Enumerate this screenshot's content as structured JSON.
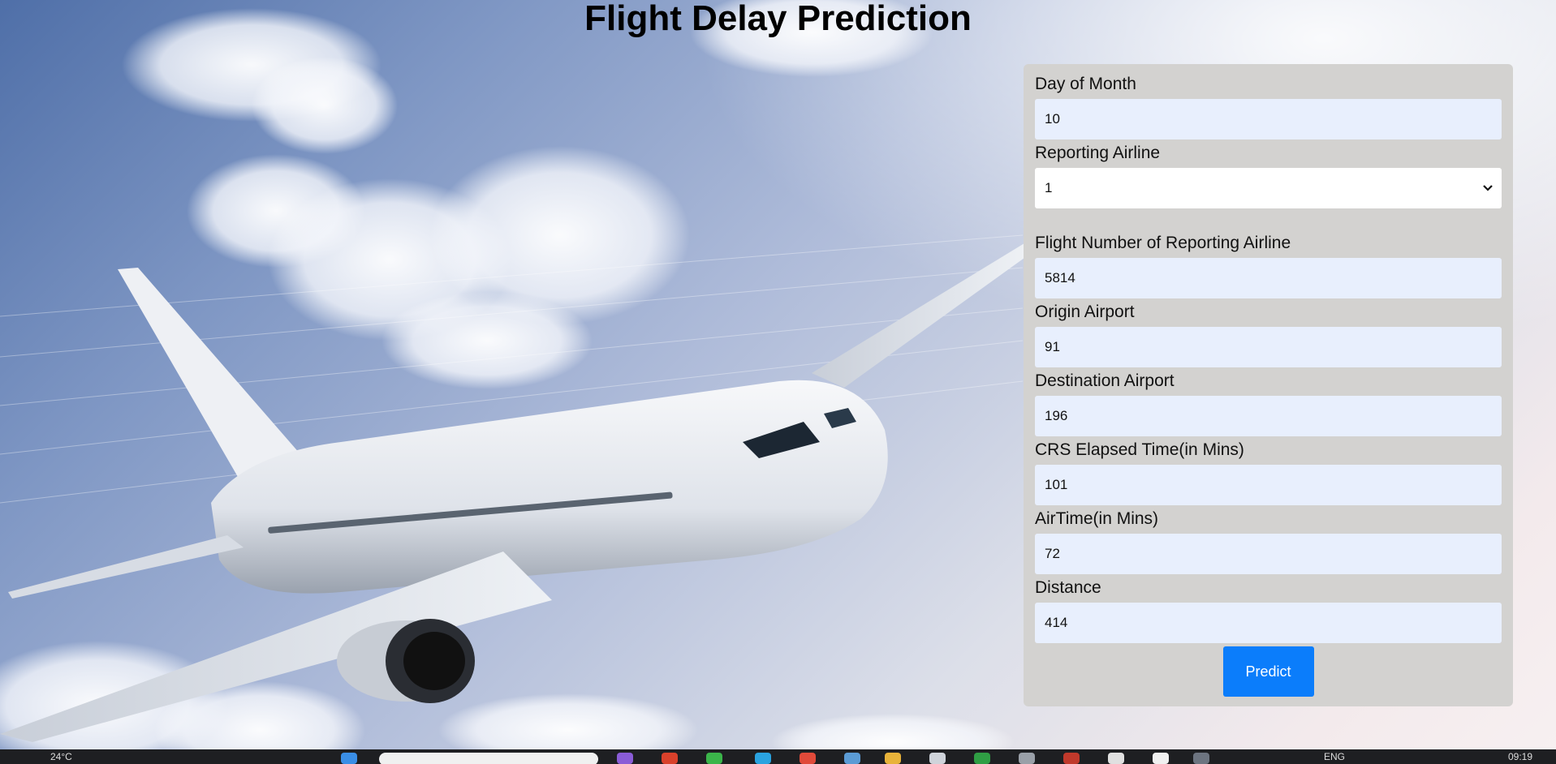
{
  "page": {
    "title": "Flight Delay Prediction"
  },
  "form": {
    "fields": [
      {
        "label": "Day of Month",
        "value": "10",
        "type": "input"
      },
      {
        "label": "Reporting Airline",
        "value": "1",
        "type": "select"
      },
      {
        "label": "Flight Number of Reporting Airline",
        "value": "5814",
        "type": "input"
      },
      {
        "label": "Origin Airport",
        "value": "91",
        "type": "input"
      },
      {
        "label": "Destination Airport",
        "value": "196",
        "type": "input"
      },
      {
        "label": "CRS Elapsed Time(in Mins)",
        "value": "101",
        "type": "input"
      },
      {
        "label": "AirTime(in Mins)",
        "value": "72",
        "type": "input"
      },
      {
        "label": "Distance",
        "value": "414",
        "type": "input"
      }
    ],
    "submit_label": "Predict"
  },
  "taskbar": {
    "weather": "24°C",
    "language": "ENG",
    "time": "09:19"
  },
  "colors": {
    "panel_bg": "#d3d2d0",
    "input_bg": "#e8effd",
    "button_bg": "#0b7dfb"
  }
}
